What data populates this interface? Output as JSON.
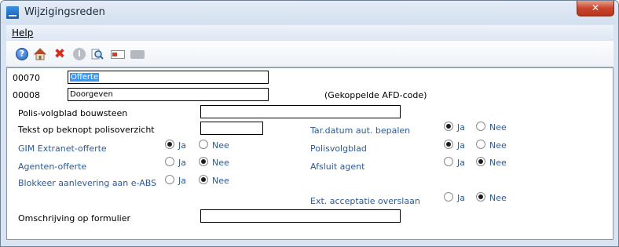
{
  "window": {
    "title": "Wijzigingsreden",
    "close_glyph": "✕"
  },
  "menu": {
    "help": "Help"
  },
  "toolbar": {
    "help_glyph": "?",
    "close_glyph": "✖",
    "info_glyph": "i",
    "icons": [
      "help-icon",
      "home-icon",
      "close-icon",
      "info-icon",
      "search-icon",
      "card-icon",
      "disabled-icon"
    ]
  },
  "form": {
    "code1": {
      "label": "00070",
      "value": "Offerte"
    },
    "code2": {
      "label": "00008",
      "value": "Doorgeven",
      "note": "(Gekoppelde AFD-code)"
    },
    "polis_bouwsteen": {
      "label": "Polis-volgblad bouwsteen",
      "value": ""
    },
    "tekst_beknopt": {
      "label": "Tekst op beknopt polisoverzicht",
      "value": ""
    },
    "tar_datum": {
      "label": "Tar.datum aut. bepalen",
      "ja": "Ja",
      "nee": "Nee",
      "selected": "Ja"
    },
    "gim_extranet": {
      "label": "GIM Extranet-offerte",
      "ja": "Ja",
      "nee": "Nee",
      "selected": "Ja"
    },
    "polisvolgblad": {
      "label": "Polisvolgblad",
      "ja": "Ja",
      "nee": "Nee",
      "selected": "Ja"
    },
    "agenten_offerte": {
      "label": "Agenten-offerte",
      "ja": "Ja",
      "nee": "Nee",
      "selected": "Nee"
    },
    "afsluit_agent": {
      "label": "Afsluit agent",
      "ja": "Ja",
      "nee": "Nee",
      "selected": "Nee"
    },
    "blokkeer": {
      "label": "Blokkeer aanlevering aan e-ABS",
      "ja": "Ja",
      "nee": "Nee",
      "selected": "Nee"
    },
    "ext_acceptatie": {
      "label": "Ext. acceptatie overslaan",
      "ja": "Ja",
      "nee": "Nee",
      "selected": "Nee"
    },
    "omschrijving": {
      "label": "Omschrijving op formulier",
      "value": ""
    }
  },
  "colors": {
    "accent_label": "#2b5a94",
    "selection": "#3399ff",
    "close_button": "#c8452d"
  }
}
